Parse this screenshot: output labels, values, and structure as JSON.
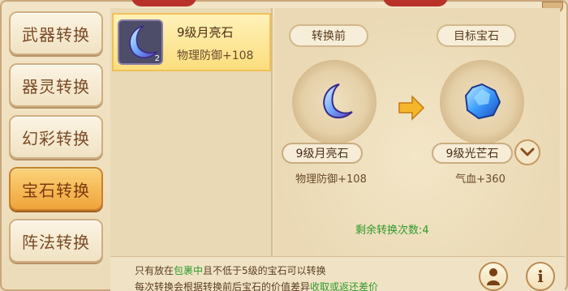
{
  "tabs": [
    {
      "label": "武器转换",
      "active": false
    },
    {
      "label": "器灵转换",
      "active": false
    },
    {
      "label": "幻彩转换",
      "active": false
    },
    {
      "label": "宝石转换",
      "active": true
    },
    {
      "label": "阵法转换",
      "active": false
    }
  ],
  "list": {
    "items": [
      {
        "name": "9级月亮石",
        "stat": "物理防御+108",
        "badge": "2",
        "icon": "moonstone-icon"
      }
    ]
  },
  "convert": {
    "before_label": "转换前",
    "target_label": "目标宝石",
    "before_name": "9级月亮石",
    "before_stat": "物理防御+108",
    "target_name": "9级光芒石",
    "target_stat": "气血+360",
    "remaining": "剩余转换次数:4"
  },
  "footer": {
    "line1_pre": "只有放在",
    "line1_hl": "包裹中",
    "line1_post": "且不低于5级的宝石可以转换",
    "line2_pre": "每次转换会根据转换前后宝石的价值差异",
    "line2_hl": "收取或返还差价"
  },
  "colors": {
    "accent_green": "#2e9a2b",
    "active_tab": "#f0a43a",
    "text_brown": "#5c3d22"
  }
}
